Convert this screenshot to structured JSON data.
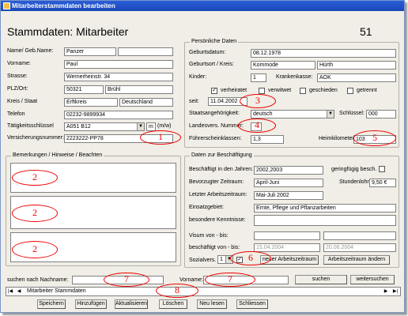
{
  "window": {
    "title": "Mitarbeiterstammdaten bearbeiten"
  },
  "header": {
    "title": "Stammdaten: Mitarbeiter",
    "record_id": "51"
  },
  "left": {
    "name_label": "Name/ Geb.Name:",
    "name_value": "Panzer",
    "geb_name_value": "",
    "vorname_label": "Vorname:",
    "vorname_value": "Paul",
    "strasse_label": "Strasse:",
    "strasse_value": "Wernerheinstr. 34",
    "plz_label": "PLZ/Ort:",
    "plz_value": "50321",
    "ort_value": "Brühl",
    "kreis_label": "Kreis / Staat",
    "kreis_value": "Erftkreis",
    "staat_value": "Deutschland",
    "telefon_label": "Telefon",
    "telefon_value": "02232-9899934",
    "taetigkeit_label": "Tätigkeitsschlüssel",
    "taetigkeit_value": "A051 B12",
    "m_value": "m",
    "m_unit": "(m/w)",
    "versicherung_label": "Versicherungsnummer:",
    "versicherung_value": "2223222-PP78"
  },
  "personal": {
    "group_label": "Persönliche Daten",
    "geburtsdatum_label": "Geburtsdatum:",
    "geburtsdatum_value": "08.12.1978",
    "geburtsort_label": "Geburtsort / Kreis:",
    "geburtsort_value": "Kommode",
    "geburtskreis_value": "Hürth",
    "kinder_label": "Kinder:",
    "kinder_value": "1",
    "krankenkasse_label": "Krankenkasse:",
    "krankenkasse_value": "AOK",
    "verheiratet": "verheiratet",
    "verwitwet": "verwitwet",
    "geschieden": "geschieden",
    "getrennt": "getrennt",
    "verheiratet_check": "✓",
    "seit_label": "seit:",
    "seit_value": "11.04.2002",
    "staatsang_label": "Staatsangehörigkeit:",
    "staatsang_value": "deutsch",
    "schluessel_label": "Schlüssel:",
    "schluessel_value": "000",
    "landesvers_label": "Landesvers. Nummer:",
    "landesvers_value": "",
    "fuehrerschein_label": "Führerscheinklassen:",
    "fuehrerschein_value": "1,3",
    "heimkilometer_label": "Heimkilometer:",
    "heimkilometer_value": "103"
  },
  "remarks": {
    "group_label": "Bemerkungen / Hinweise / Beachten"
  },
  "employment": {
    "group_label": "Daten zur Beschäftigung",
    "jahre_label": "Beschäftigt in den Jahren:",
    "jahre_value": "2002,2003",
    "geringfuegig_label": "geringfügig besch.",
    "zeitraum_label": "Bevorzugter Zeitraum:",
    "zeitraum_value": "April-Juni",
    "stundenlohn_label": "Stundenlohn:",
    "stundenlohn_value": "9,50 €",
    "letzter_label": "Letzter Arbeitszeitraum:",
    "letzter_value": "Mai-Juli 2002",
    "einsatz_label": "Einsatzgebiet:",
    "einsatz_value": "Ernte, Pflege und Pflanzarbeiten",
    "kenntnisse_label": "besondere Kenntnisse:",
    "kenntnisse_value": "",
    "visum_label": "Visum von - bis:",
    "visum_from": "",
    "visum_to": "",
    "beschaeftigt_label": "beschäftigt von - bis:",
    "beschaeftigt_from": "15.04.2004",
    "beschaeftigt_to": "20.06.2004",
    "sozialvers_label": "Sozialvers.",
    "sozialvers_value": "1",
    "sozial_check": "✓",
    "neuer_btn": "neuer Arbeitszeitraum",
    "aendern_btn": "Arbeitszeitraum ändern"
  },
  "search": {
    "nachname_label": "suchen nach Nachname:",
    "vorname_label": "Vorname:",
    "suchen_btn": "suchen",
    "weiter_btn": "weitersuchen"
  },
  "record_nav": {
    "label": "Mitarbeiter Stammdaten"
  },
  "toolbar": {
    "speichern": "Speichern",
    "hinzufuegen": "Hinzufügen",
    "aktualisieren": "Aktualisieren",
    "loeschen": "Löschen",
    "neu_lesen": "Neu lesen",
    "schliessen": "Schliessen"
  },
  "annotations": {
    "a1": "1",
    "a2": "2",
    "a3": "3",
    "a4": "4",
    "a5": "5",
    "a6": "6",
    "a7": "7",
    "a8": "8"
  }
}
